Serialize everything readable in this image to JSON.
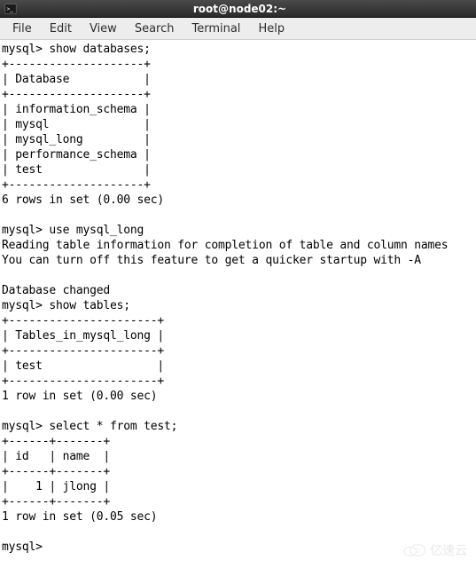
{
  "window": {
    "title": "root@node02:~"
  },
  "menubar": {
    "items": [
      "File",
      "Edit",
      "View",
      "Search",
      "Terminal",
      "Help"
    ]
  },
  "terminal": {
    "lines": [
      "mysql> show databases;",
      "+--------------------+",
      "| Database           |",
      "+--------------------+",
      "| information_schema |",
      "| mysql              |",
      "| mysql_long         |",
      "| performance_schema |",
      "| test               |",
      "+--------------------+",
      "6 rows in set (0.00 sec)",
      "",
      "mysql> use mysql_long",
      "Reading table information for completion of table and column names",
      "You can turn off this feature to get a quicker startup with -A",
      "",
      "Database changed",
      "mysql> show tables;",
      "+----------------------+",
      "| Tables_in_mysql_long |",
      "+----------------------+",
      "| test                 |",
      "+----------------------+",
      "1 row in set (0.00 sec)",
      "",
      "mysql> select * from test;",
      "+------+-------+",
      "| id   | name  |",
      "+------+-------+",
      "|    1 | jlong |",
      "+------+-------+",
      "1 row in set (0.05 sec)",
      "",
      "mysql> "
    ]
  },
  "watermark": {
    "text": "亿速云"
  }
}
